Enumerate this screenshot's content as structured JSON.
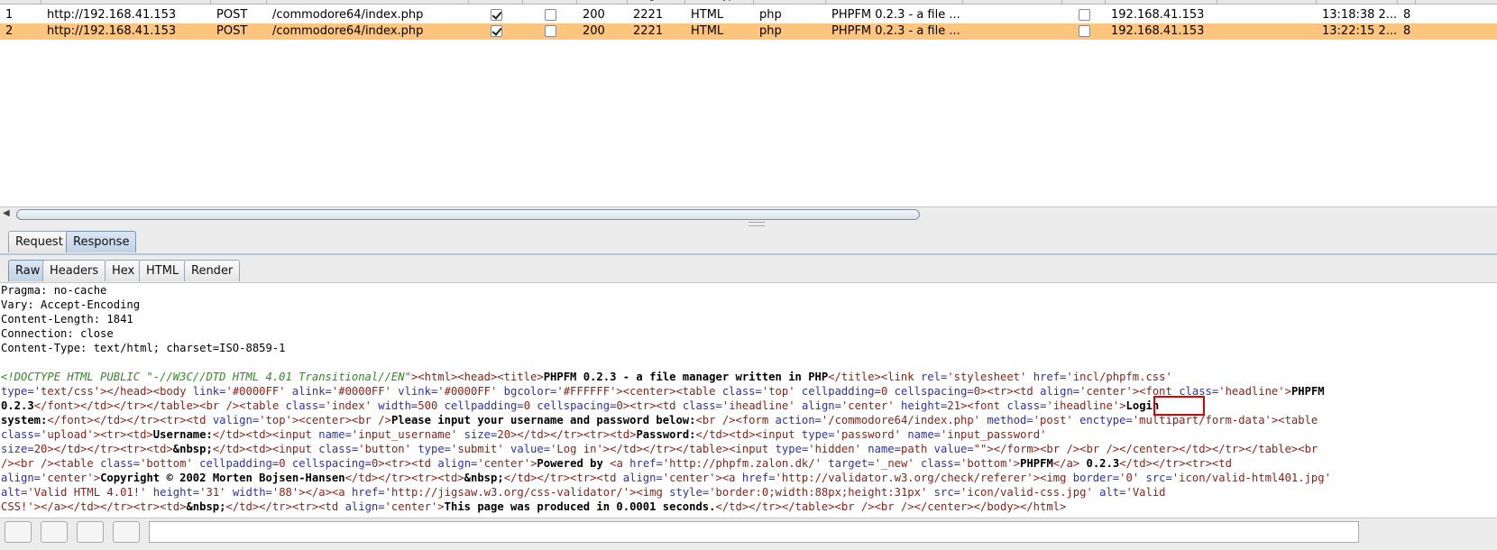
{
  "history": {
    "headers": [
      "#",
      "Host",
      "Method",
      "URL",
      "Params",
      "Edited",
      "Status",
      "Length",
      "MIME type",
      "Extension",
      "Title",
      "Comment",
      "SSL",
      "IP",
      "Cookies",
      "Time",
      "L"
    ],
    "rows": [
      {
        "num": "1",
        "host": "http://192.168.41.153",
        "method": "POST",
        "url": "/commodore64/index.php",
        "params": true,
        "edited": false,
        "status": "200",
        "length": "2221",
        "mime": "HTML",
        "ext": "php",
        "title": "PHPFM 0.2.3 - a file ...",
        "ssl": false,
        "ip": "192.168.41.153",
        "time": "13:18:38 2...",
        "extra": "8"
      },
      {
        "num": "2",
        "host": "http://192.168.41.153",
        "method": "POST",
        "url": "/commodore64/index.php",
        "params": true,
        "edited": false,
        "status": "200",
        "length": "2221",
        "mime": "HTML",
        "ext": "php",
        "title": "PHPFM 0.2.3 - a file ...",
        "ssl": false,
        "ip": "192.168.41.153",
        "time": "13:22:15 2...",
        "extra": "8"
      }
    ]
  },
  "tabs_top": [
    "Request",
    "Response"
  ],
  "tabs_sub": [
    "Raw",
    "Headers",
    "Hex",
    "HTML",
    "Render"
  ],
  "headers_lines": [
    "Pragma: no-cache",
    "Vary: Accept-Encoding",
    "Content-Length: 1841",
    "Connection: close",
    "Content-Type: text/html; charset=ISO-8859-1"
  ],
  "body_lines": [
    [
      [
        "d",
        "<!DOCTYPE HTML PUBLIC \"-//W3C//DTD HTML 4.01 Transitional//EN\""
      ],
      [
        "t",
        ">"
      ],
      [
        "t",
        "<html><head><title>"
      ],
      [
        "b",
        "PHPFM 0.2.3 - a file manager written in PHP"
      ],
      [
        "t",
        "</title><link "
      ],
      [
        "a",
        "rel="
      ],
      [
        "v",
        "'stylesheet' "
      ],
      [
        "a",
        "href="
      ],
      [
        "v",
        "'incl/phpfm.css'"
      ]
    ],
    [
      [
        "a",
        "type="
      ],
      [
        "v",
        "'text/css'"
      ],
      [
        "t",
        "></head><body "
      ],
      [
        "a",
        "link="
      ],
      [
        "v",
        "'#0000FF' "
      ],
      [
        "a",
        "alink="
      ],
      [
        "v",
        "'#0000FF' "
      ],
      [
        "a",
        "vlink="
      ],
      [
        "v",
        "'#0000FF' "
      ],
      [
        "a",
        "bgcolor="
      ],
      [
        "v",
        "'#FFFFFF'"
      ],
      [
        "t",
        "><center><table "
      ],
      [
        "a",
        "class="
      ],
      [
        "v",
        "'top' "
      ],
      [
        "a",
        "cellpadding="
      ],
      [
        "v",
        "0 "
      ],
      [
        "a",
        "cellspacing="
      ],
      [
        "v",
        "0"
      ],
      [
        "t",
        "><tr><td "
      ],
      [
        "a",
        "align="
      ],
      [
        "v",
        "'center'"
      ],
      [
        "t",
        "><font "
      ],
      [
        "a",
        "class="
      ],
      [
        "v",
        "'headline'"
      ],
      [
        "t",
        ">"
      ],
      [
        "b",
        "PHPFM"
      ]
    ],
    [
      [
        "b",
        "0.2.3"
      ],
      [
        "t",
        "</font></td></tr></table><br /><table "
      ],
      [
        "a",
        "class="
      ],
      [
        "v",
        "'index' "
      ],
      [
        "a",
        "width="
      ],
      [
        "v",
        "500 "
      ],
      [
        "a",
        "cellpadding="
      ],
      [
        "v",
        "0 "
      ],
      [
        "a",
        "cellspacing="
      ],
      [
        "v",
        "0"
      ],
      [
        "t",
        "><tr><td "
      ],
      [
        "a",
        "class="
      ],
      [
        "v",
        "'iheadline' "
      ],
      [
        "a",
        "align="
      ],
      [
        "v",
        "'center' "
      ],
      [
        "a",
        "height="
      ],
      [
        "v",
        "21"
      ],
      [
        "t",
        "><font "
      ],
      [
        "a",
        "class="
      ],
      [
        "v",
        "'iheadline'"
      ],
      [
        "t",
        ">"
      ],
      [
        "b",
        "Login"
      ]
    ],
    [
      [
        "b",
        "system:"
      ],
      [
        "t",
        "</font></td></tr><tr><td "
      ],
      [
        "a",
        "valign="
      ],
      [
        "v",
        "'top'"
      ],
      [
        "t",
        "><center><br />"
      ],
      [
        "b",
        "Please input your username and password below:"
      ],
      [
        "t",
        "<br /><form "
      ],
      [
        "a",
        "action="
      ],
      [
        "v",
        "'/commodore64/index.php' "
      ],
      [
        "a",
        "method="
      ],
      [
        "v",
        "'post' "
      ],
      [
        "a",
        "enctype="
      ],
      [
        "v",
        "'multipart/form-data'"
      ],
      [
        "t",
        "><table"
      ]
    ],
    [
      [
        "a",
        "class="
      ],
      [
        "v",
        "'upload'"
      ],
      [
        "t",
        "><tr><td>"
      ],
      [
        "b",
        "Username:"
      ],
      [
        "t",
        "</td><td><input "
      ],
      [
        "a",
        "name="
      ],
      [
        "v",
        "'input_username' "
      ],
      [
        "a",
        "size="
      ],
      [
        "v",
        "20"
      ],
      [
        "t",
        "></td></tr><tr><td>"
      ],
      [
        "b",
        "Password:"
      ],
      [
        "t",
        "</td><td><input "
      ],
      [
        "a",
        "type="
      ],
      [
        "v",
        "'password' "
      ],
      [
        "a",
        "name="
      ],
      [
        "v",
        "'input_password'"
      ]
    ],
    [
      [
        "a",
        "size="
      ],
      [
        "v",
        "20"
      ],
      [
        "t",
        "></td></tr><tr><td>"
      ],
      [
        "b",
        "&nbsp;"
      ],
      [
        "t",
        "</td><td><input "
      ],
      [
        "a",
        "class="
      ],
      [
        "v",
        "'button' "
      ],
      [
        "a",
        "type="
      ],
      [
        "v",
        "'submit' "
      ],
      [
        "a",
        "value="
      ],
      [
        "v",
        "'Log in'"
      ],
      [
        "t",
        "></td></tr></table><input "
      ],
      [
        "a",
        "type="
      ],
      [
        "v",
        "'hidden' "
      ],
      [
        "a",
        "name="
      ],
      [
        "v",
        "path "
      ],
      [
        "a",
        "value="
      ],
      [
        "v",
        "\"\""
      ],
      [
        "t",
        "></form><br /><br /></center></td></tr></table><br"
      ]
    ],
    [
      [
        "t",
        "/><br /><table "
      ],
      [
        "a",
        "class="
      ],
      [
        "v",
        "'bottom' "
      ],
      [
        "a",
        "cellpadding="
      ],
      [
        "v",
        "0 "
      ],
      [
        "a",
        "cellspacing="
      ],
      [
        "v",
        "0"
      ],
      [
        "t",
        "><tr><td "
      ],
      [
        "a",
        "align="
      ],
      [
        "v",
        "'center'"
      ],
      [
        "t",
        ">"
      ],
      [
        "b",
        "Powered by "
      ],
      [
        "t",
        "<a "
      ],
      [
        "a",
        "href="
      ],
      [
        "v",
        "'http://phpfm.zalon.dk/' "
      ],
      [
        "a",
        "target="
      ],
      [
        "v",
        "'_new' "
      ],
      [
        "a",
        "class="
      ],
      [
        "v",
        "'bottom'"
      ],
      [
        "t",
        ">"
      ],
      [
        "b",
        "PHPFM"
      ],
      [
        "t",
        "</a>"
      ],
      [
        "b",
        " 0.2.3"
      ],
      [
        "t",
        "</td></tr><tr><td"
      ]
    ],
    [
      [
        "a",
        "align="
      ],
      [
        "v",
        "'center'"
      ],
      [
        "t",
        ">"
      ],
      [
        "b",
        "Copyright © 2002 Morten Bojsen-Hansen"
      ],
      [
        "t",
        "</td></tr><tr><td>"
      ],
      [
        "b",
        "&nbsp;"
      ],
      [
        "t",
        "</td></tr><tr><td "
      ],
      [
        "a",
        "align="
      ],
      [
        "v",
        "'center'"
      ],
      [
        "t",
        "><a "
      ],
      [
        "a",
        "href="
      ],
      [
        "v",
        "'http://validator.w3.org/check/referer'"
      ],
      [
        "t",
        "><img "
      ],
      [
        "a",
        "border="
      ],
      [
        "v",
        "'0' "
      ],
      [
        "a",
        "src="
      ],
      [
        "v",
        "'icon/valid-html401.jpg'"
      ]
    ],
    [
      [
        "a",
        "alt="
      ],
      [
        "v",
        "'Valid HTML 4.01!' "
      ],
      [
        "a",
        "height="
      ],
      [
        "v",
        "'31' "
      ],
      [
        "a",
        "width="
      ],
      [
        "v",
        "'88'"
      ],
      [
        "t",
        "></a><a "
      ],
      [
        "a",
        "href="
      ],
      [
        "v",
        "'http://jigsaw.w3.org/css-validator/'"
      ],
      [
        "t",
        "><img "
      ],
      [
        "a",
        "style="
      ],
      [
        "v",
        "'border:0;width:88px;height:31px' "
      ],
      [
        "a",
        "src="
      ],
      [
        "v",
        "'icon/valid-css.jpg' "
      ],
      [
        "a",
        "alt="
      ],
      [
        "v",
        "'Valid"
      ]
    ],
    [
      [
        "v",
        "CSS!'"
      ],
      [
        "t",
        "></a></td></tr><tr><td>"
      ],
      [
        "b",
        "&nbsp;"
      ],
      [
        "t",
        "</td></tr><tr><td "
      ],
      [
        "a",
        "align="
      ],
      [
        "v",
        "'center'"
      ],
      [
        "t",
        ">"
      ],
      [
        "b",
        "This page was produced in 0.0001 seconds."
      ],
      [
        "t",
        "</td></tr></table><br /><br /></center></body></html>"
      ]
    ]
  ],
  "colors": {
    "selected_row": "#fdc57e",
    "tag": "#8a1f12",
    "attr": "#2b2fb7",
    "doctype": "#2e8b1f",
    "highlight_box": "#e00000"
  }
}
